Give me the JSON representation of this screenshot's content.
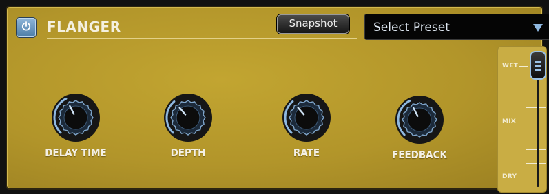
{
  "plugin": {
    "title": "FLANGER",
    "power_on": true,
    "power_icon": "power-icon"
  },
  "header": {
    "snapshot_label": "Snapshot",
    "preset_select": {
      "selected": "Select Preset",
      "arrow_icon": "chevron-down-icon"
    }
  },
  "knobs": [
    {
      "label": "DELAY TIME",
      "value": 0.4
    },
    {
      "label": "DEPTH",
      "value": 0.35
    },
    {
      "label": "RATE",
      "value": 0.35
    },
    {
      "label": "FEEDBACK",
      "value": 0.4
    }
  ],
  "mix": {
    "labels": {
      "wet": "WET",
      "mix": "MIX",
      "dry": "DRY"
    },
    "value": 1.0
  },
  "colors": {
    "panel": "#b69a2c",
    "accent_blue": "#8fb8e0",
    "label_text": "#f4f0e4"
  }
}
